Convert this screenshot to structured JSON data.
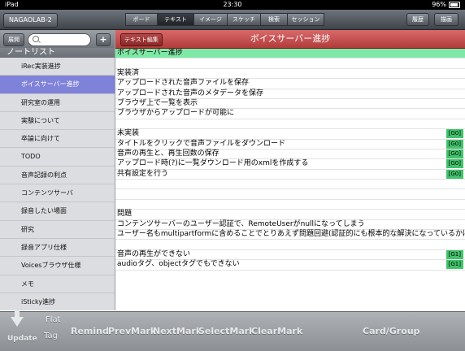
{
  "status": {
    "carrier": "iPad",
    "time": "23:30",
    "battery": "96%"
  },
  "toolbar": {
    "app": "NAGAOLAB-2",
    "tabs": [
      "ボード",
      "テキスト",
      "イメージ",
      "スケッチ",
      "検索",
      "セッション"
    ],
    "history": "履歴",
    "draw": "描画"
  },
  "sidebar": {
    "expand": "展開",
    "add": "+",
    "title": "ノートリスト",
    "items": [
      "iRec実装進捗",
      "ボイスサーバー進捗",
      "研究室の運用",
      "実験について",
      "卒論に向けて",
      "TODO",
      "音声記録の利点",
      "コンテンツサーバ",
      "録音したい場面",
      "研究",
      "録音アプリ仕様",
      "Voicesブラウザ仕様",
      "メモ",
      "iSticky進捗"
    ]
  },
  "main": {
    "edit": "テキスト編集",
    "title": "ボイスサーバー進捗",
    "rows": [
      {
        "text": "ボイスサーバー進捗",
        "tag": ""
      },
      {
        "text": "",
        "tag": ""
      },
      {
        "text": "実装済",
        "tag": ""
      },
      {
        "text": "アップロードされた音声ファイルを保存",
        "tag": ""
      },
      {
        "text": "アップロードされた音声のメタデータを保存",
        "tag": ""
      },
      {
        "text": "ブラウザ上で一覧を表示",
        "tag": ""
      },
      {
        "text": "ブラウザからアップロードが可能に",
        "tag": ""
      },
      {
        "text": "",
        "tag": ""
      },
      {
        "text": "未実装",
        "tag": "[G0]"
      },
      {
        "text": "タイトルをクリックで音声ファイルをダウンロード",
        "tag": "[G0]"
      },
      {
        "text": "音声の再生と、再生回数の保存",
        "tag": "[G0]"
      },
      {
        "text": "アップロード時(?)に一覧ダウンロード用のxmlを作成する",
        "tag": "[G0]"
      },
      {
        "text": "共有設定を行う",
        "tag": "[G0]"
      },
      {
        "text": "",
        "tag": ""
      },
      {
        "text": "",
        "tag": ""
      },
      {
        "text": "",
        "tag": ""
      },
      {
        "text": "問題",
        "tag": ""
      },
      {
        "text": "コンテンツサーバーのユーザー認証で、RemoteUserがnullになってしまう",
        "tag": ""
      },
      {
        "text": "ユーザー名もmultipartformに含めることでとりあえず問題回避(認証的にも根本的な解決になっているかは不明)",
        "tag": ""
      },
      {
        "text": "",
        "tag": ""
      },
      {
        "text": "音声の再生ができない",
        "tag": "[G1]"
      },
      {
        "text": "audioタグ、objectタグでもできない",
        "tag": "[G1]"
      }
    ]
  },
  "bottom": {
    "update": "Update",
    "flat": "Flat",
    "tag": "Tag",
    "remind": "Remind",
    "prevmark": "PrevMark",
    "nextmark": "NextMark",
    "selectmark": "SelectMark",
    "clearmark": "ClearMark",
    "cardgroup": "Card/Group"
  }
}
